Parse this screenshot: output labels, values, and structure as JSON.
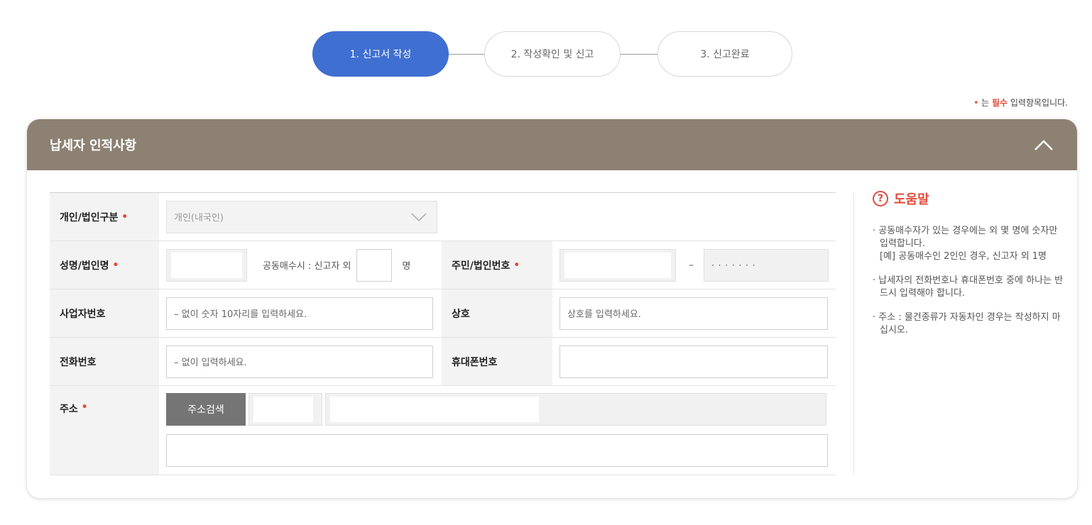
{
  "steps": [
    {
      "label": "1. 신고서 작성",
      "active": true
    },
    {
      "label": "2. 작성확인 및 신고",
      "active": false
    },
    {
      "label": "3. 신고완료",
      "active": false
    }
  ],
  "required_note": {
    "dot": "•",
    "pre": " 는 ",
    "strong": "필수",
    "post": " 입력항목입니다."
  },
  "panel": {
    "title": "납세자 인적사항",
    "collapse_icon": "chevron-up-icon"
  },
  "form": {
    "type_label": "개인/법인구분",
    "type_value": "개인(내국인)",
    "name_label": "성명/법인명",
    "joint_text": "공동매수시 : 신고자 외",
    "joint_unit": "명",
    "id_label": "주민/법인번호",
    "id_dash": "–",
    "id_mask": "· · · · · · ·",
    "biz_label": "사업자번호",
    "biz_placeholder": "– 없이 숫자 10자리를 입력하세요.",
    "trade_label": "상호",
    "trade_placeholder": "상호를 입력하세요.",
    "phone_label": "전화번호",
    "phone_placeholder": "– 없이 입력하세요.",
    "mobile_label": "휴대폰번호",
    "address_label": "주소",
    "address_button": "주소검색",
    "required_mark": "•"
  },
  "help": {
    "title": "도움말",
    "icon": "?",
    "items": [
      {
        "text": "· 공동매수자가 있는 경우에는 외 몇 명에 숫자만 입력합니다.",
        "sub": "[예] 공동매수인 2인인 경우, 신고자 외 1명"
      },
      {
        "text": "· 납세자의 전화번호나 휴대폰번호 중에 하나는 반드시 입력해야 합니다."
      },
      {
        "text": "· 주소 : 물건종류가 자동차인 경우는 작성하지 마십시오."
      }
    ]
  },
  "colors": {
    "accent": "#3f6fd1",
    "header": "#8c8172",
    "required": "#e14b3b"
  }
}
